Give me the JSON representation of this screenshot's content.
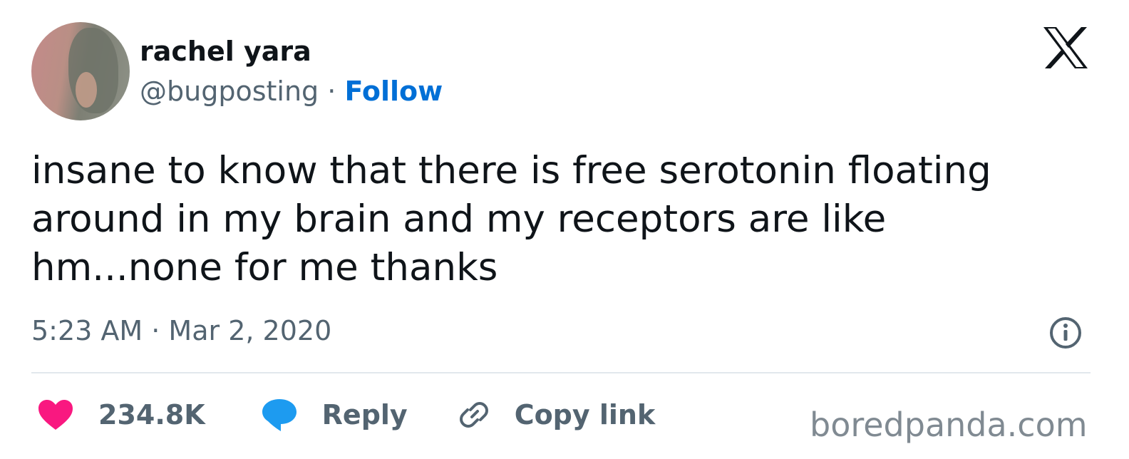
{
  "author": {
    "name": "rachel yara",
    "handle": "@bugposting",
    "separator": "·",
    "follow_label": "Follow"
  },
  "tweet": {
    "text": "insane to know that there is free serotonin floating\naround in my brain and my receptors are like\nhm...none for me thanks",
    "timestamp": "5:23 AM · Mar 2, 2020"
  },
  "actions": {
    "like_count": "234.8K",
    "reply_label": "Reply",
    "copy_link_label": "Copy link"
  },
  "watermark": "boredpanda.com",
  "icons": {
    "platform": "x-logo-icon",
    "info": "info-icon",
    "like": "heart-icon",
    "reply": "speech-bubble-icon",
    "copy": "link-icon"
  },
  "colors": {
    "follow": "#006fd6",
    "heart": "#f91880",
    "reply_bubble": "#1d9bf0",
    "secondary_text": "#536471",
    "divider": "#e1e8ed"
  }
}
